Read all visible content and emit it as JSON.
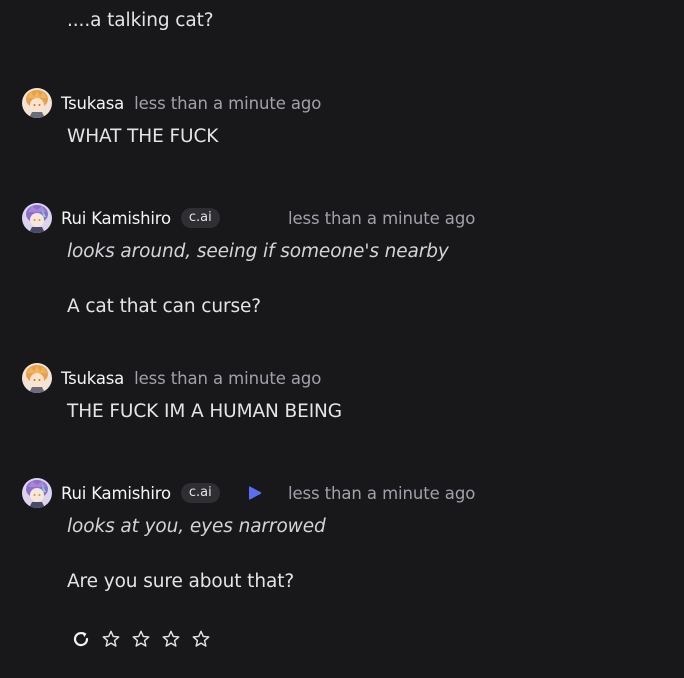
{
  "messages": [
    {
      "text_lines": [
        "....a talking cat?"
      ]
    },
    {
      "author": "Tsukasa",
      "time": "less than a minute ago",
      "avatar_icon": "tsukasa-avatar",
      "text_lines": [
        "WHAT THE FUCK"
      ]
    },
    {
      "author": "Rui Kamishiro",
      "badge": "c.ai",
      "time": "less than a minute ago",
      "avatar_icon": "rui-avatar",
      "action_line": "looks around, seeing if someone's nearby",
      "text_lines": [
        "A cat that can curse?"
      ]
    },
    {
      "author": "Tsukasa",
      "time": "less than a minute ago",
      "avatar_icon": "tsukasa-avatar",
      "text_lines": [
        "THE FUCK IM A HUMAN BEING"
      ]
    },
    {
      "author": "Rui Kamishiro",
      "badge": "c.ai",
      "time": "less than a minute ago",
      "avatar_icon": "rui-avatar",
      "play_icon": "play-icon",
      "action_line": "looks at you, eyes narrowed",
      "text_lines": [
        "Are you sure about that?"
      ]
    }
  ],
  "actions": {
    "regenerate_icon": "refresh-icon",
    "rating": {
      "icon": "star-icon",
      "max": 5,
      "value": 0,
      "visible_count": 4
    }
  },
  "colors": {
    "background": "#18181b",
    "text": "#e4e4e7",
    "muted": "#a1a1aa",
    "badge_bg": "#2e2e33",
    "play_accent": "#5b6cf5"
  }
}
